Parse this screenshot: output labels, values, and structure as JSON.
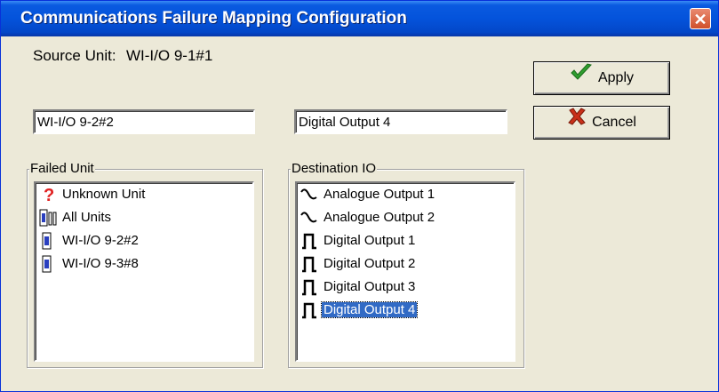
{
  "window": {
    "title": "Communications Failure Mapping Configuration",
    "close_symbol": "✕"
  },
  "source_unit": {
    "label": "Source Unit:",
    "value": "WI-I/O 9-1#1"
  },
  "fields": {
    "failed_unit_value": "WI-I/O 9-2#2",
    "destination_value": "Digital Output 4"
  },
  "buttons": {
    "apply": "Apply",
    "cancel": "Cancel"
  },
  "failed_unit": {
    "title": "Failed Unit",
    "items": [
      {
        "label": "Unknown Unit",
        "icon": "question-icon"
      },
      {
        "label": "All Units",
        "icon": "all-units-icon"
      },
      {
        "label": "WI-I/O 9-2#2",
        "icon": "unit-icon"
      },
      {
        "label": "WI-I/O 9-3#8",
        "icon": "unit-icon"
      }
    ]
  },
  "destination_io": {
    "title": "Destination IO",
    "items": [
      {
        "label": "Analogue Output 1",
        "icon": "analogue-icon"
      },
      {
        "label": "Analogue Output 2",
        "icon": "analogue-icon"
      },
      {
        "label": "Digital Output 1",
        "icon": "digital-icon"
      },
      {
        "label": "Digital Output 2",
        "icon": "digital-icon"
      },
      {
        "label": "Digital Output 3",
        "icon": "digital-icon"
      },
      {
        "label": "Digital Output 4",
        "icon": "digital-icon",
        "selected": true
      }
    ]
  },
  "colors": {
    "title_bar": "#0453db",
    "selection": "#316ac5",
    "dialog": "#ece9d8"
  }
}
